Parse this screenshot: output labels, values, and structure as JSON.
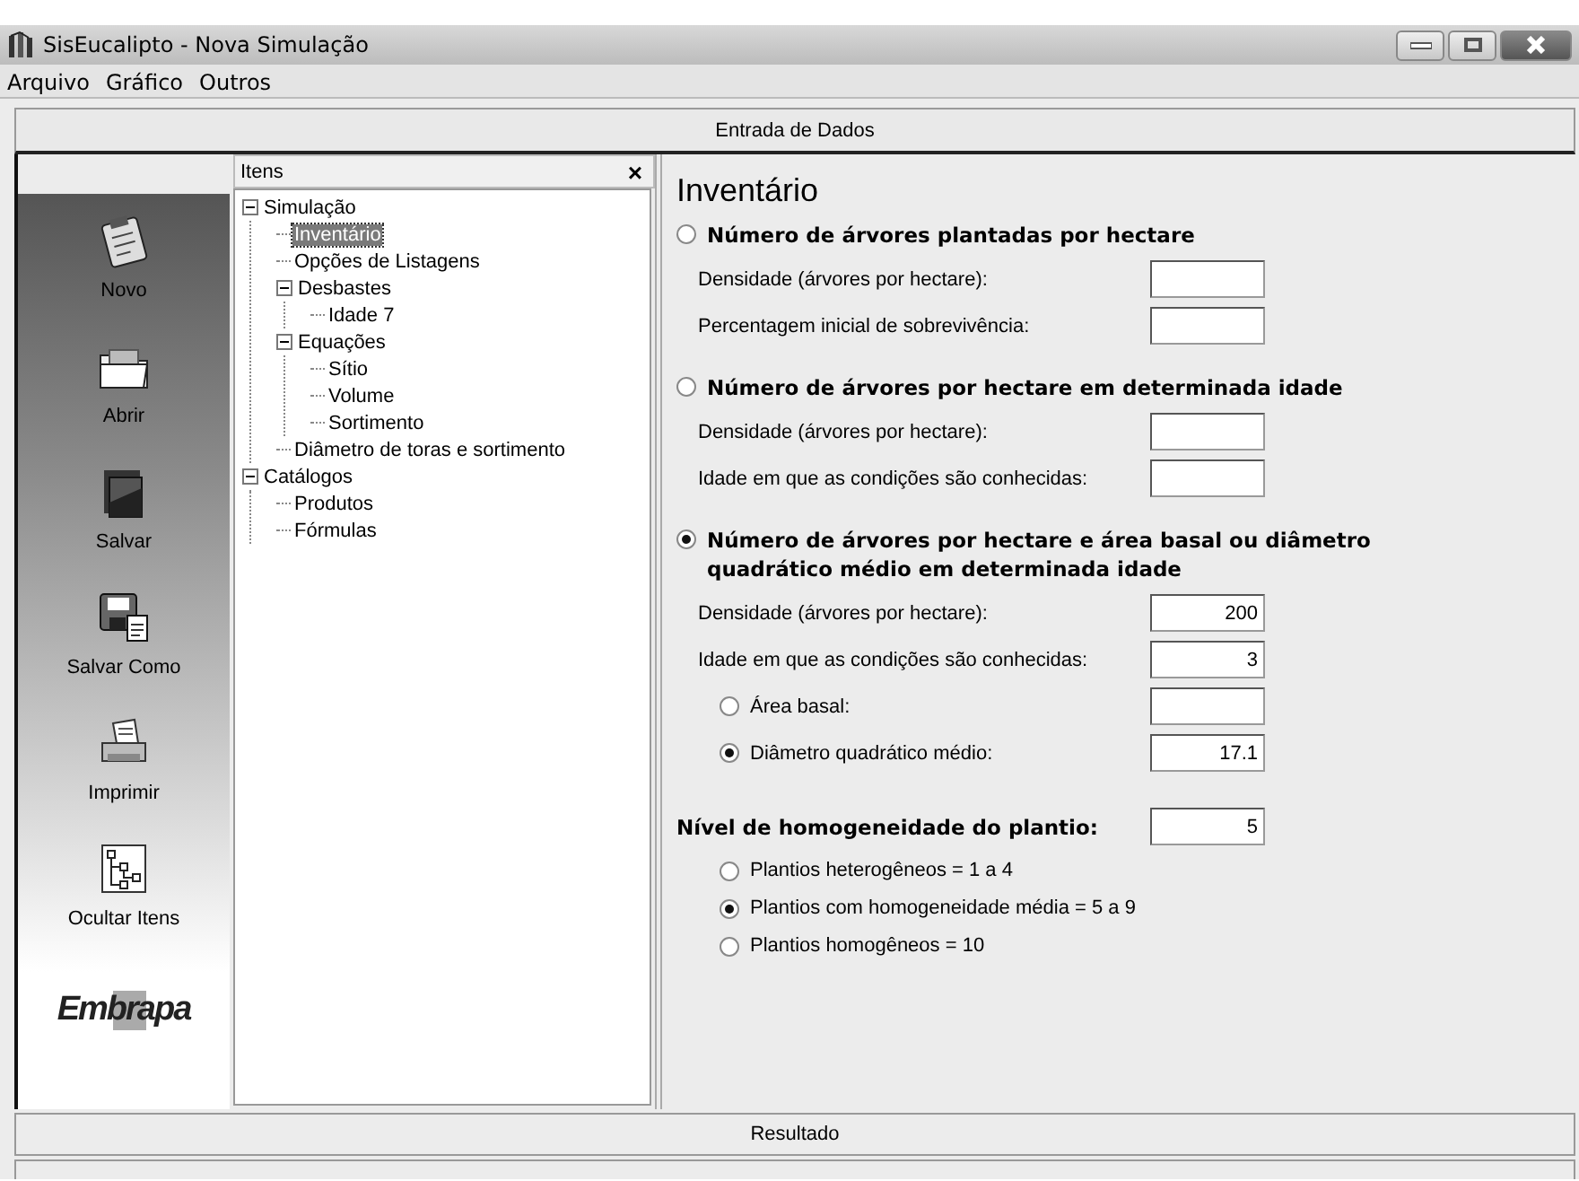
{
  "window": {
    "title": "SisEucalipto - Nova Simulação"
  },
  "menu": [
    "Arquivo",
    "Gráfico",
    "Outros"
  ],
  "input_bar": "Entrada de Dados",
  "toolbar": [
    {
      "label": "Novo"
    },
    {
      "label": "Abrir"
    },
    {
      "label": "Salvar"
    },
    {
      "label": "Salvar Como"
    },
    {
      "label": "Imprimir"
    },
    {
      "label": "Ocultar Itens"
    }
  ],
  "logo": "Embrapa",
  "tree_panel": {
    "title": "Itens",
    "close": "×",
    "items": [
      {
        "label": "Simulação",
        "expanded": true,
        "selected": false,
        "children": [
          {
            "label": "Inventário",
            "selected": true
          },
          {
            "label": "Opções de Listagens",
            "selected": false
          },
          {
            "label": "Desbastes",
            "expanded": true,
            "selected": false,
            "children": [
              {
                "label": "Idade 7",
                "selected": false
              }
            ]
          },
          {
            "label": "Equações",
            "expanded": true,
            "selected": false,
            "children": [
              {
                "label": "Sítio",
                "selected": false
              },
              {
                "label": "Volume",
                "selected": false
              },
              {
                "label": "Sortimento",
                "selected": false
              }
            ]
          },
          {
            "label": "Diâmetro de toras e sortimento",
            "selected": false
          }
        ]
      },
      {
        "label": "Catálogos",
        "expanded": true,
        "selected": false,
        "children": [
          {
            "label": "Produtos",
            "selected": false
          },
          {
            "label": "Fórmulas",
            "selected": false
          }
        ]
      }
    ]
  },
  "form": {
    "title": "Inventário",
    "options": [
      {
        "label": "Número de árvores plantadas por hectare",
        "selected": false,
        "fields": [
          {
            "kind": "text",
            "label": "Densidade (árvores por hectare):"
          },
          {
            "kind": "text",
            "label": "Percentagem inicial de sobrevivência:"
          }
        ]
      },
      {
        "label": "Número de árvores por hectare em determinada idade",
        "selected": false,
        "fields": [
          {
            "kind": "text",
            "label": "Densidade (árvores por hectare):"
          },
          {
            "kind": "text",
            "label": "Idade em que as condições são conhecidas:"
          }
        ]
      },
      {
        "label": "Número de árvores por hectare e área basal ou diâmetro quadrático médio em determinada idade",
        "selected": true,
        "fields": [
          {
            "kind": "text",
            "label": "Densidade (árvores por hectare):",
            "value": "200"
          },
          {
            "kind": "text",
            "label": "Idade em que as condições são conhecidas:",
            "value": "3"
          },
          {
            "kind": "radio",
            "label": "Área basal:",
            "selected": false
          },
          {
            "kind": "radio",
            "label": "Diâmetro quadrático médio:",
            "selected": true,
            "value": "17.1"
          }
        ]
      }
    ],
    "homogeneity": {
      "label": "Nível de homogeneidade do plantio:",
      "value": "5",
      "options": [
        {
          "label": "Plantios heterogêneos = 1 a 4",
          "selected": false
        },
        {
          "label": "Plantios com homogeneidade média = 5 a 9",
          "selected": true
        },
        {
          "label": "Plantios homogêneos = 10",
          "selected": false
        }
      ]
    }
  },
  "result_bar": "Resultado"
}
